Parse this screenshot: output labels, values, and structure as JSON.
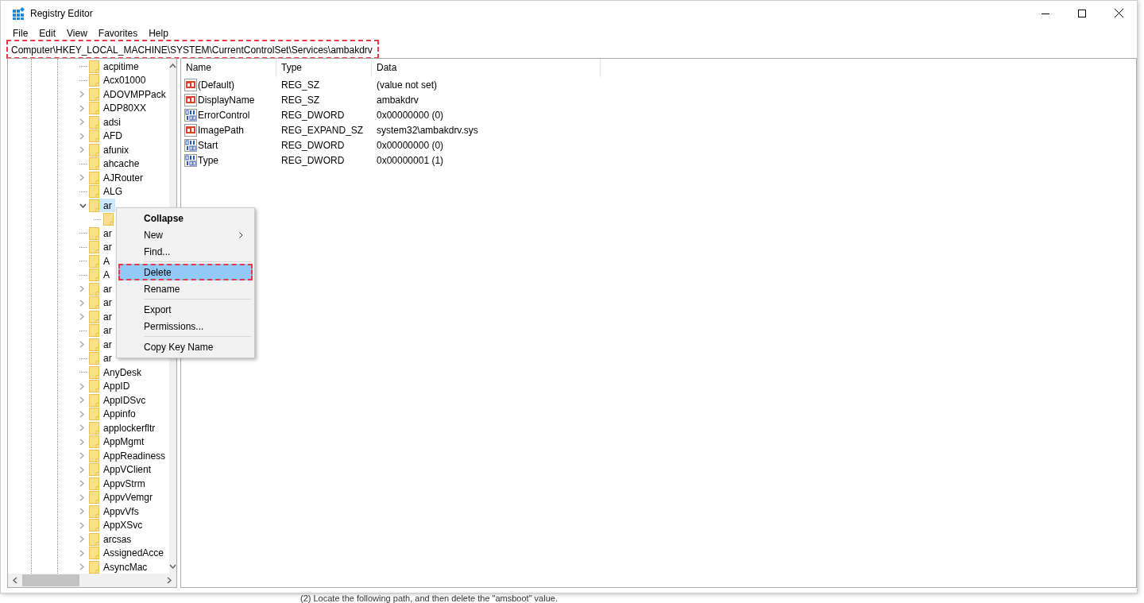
{
  "window": {
    "title": "Registry Editor"
  },
  "menu_bar": [
    "File",
    "Edit",
    "View",
    "Favorites",
    "Help"
  ],
  "address_bar": {
    "value": "Computer\\HKEY_LOCAL_MACHINE\\SYSTEM\\CurrentControlSet\\Services\\ambakdrv",
    "highlighted": true
  },
  "tree": {
    "items": [
      {
        "label": "acpitime",
        "expandable": false,
        "selected": false
      },
      {
        "label": "Acx01000",
        "expandable": false,
        "selected": false
      },
      {
        "label": "ADOVMPPack",
        "expandable": true,
        "expanded": false,
        "selected": false
      },
      {
        "label": "ADP80XX",
        "expandable": true,
        "expanded": false,
        "selected": false
      },
      {
        "label": "adsi",
        "expandable": true,
        "expanded": false,
        "selected": false
      },
      {
        "label": "AFD",
        "expandable": true,
        "expanded": false,
        "selected": false
      },
      {
        "label": "afunix",
        "expandable": true,
        "expanded": false,
        "selected": false
      },
      {
        "label": "ahcache",
        "expandable": false,
        "selected": false
      },
      {
        "label": "AJRouter",
        "expandable": true,
        "expanded": false,
        "selected": false
      },
      {
        "label": "ALG",
        "expandable": false,
        "selected": false
      },
      {
        "label": "ar",
        "expandable": true,
        "expanded": true,
        "selected": true,
        "children": [
          {
            "expandable": false,
            "selected": false
          }
        ]
      },
      {
        "label": "ar",
        "expandable": false,
        "selected": false
      },
      {
        "label": "ar",
        "expandable": false,
        "selected": false
      },
      {
        "label": "A",
        "expandable": false,
        "selected": false
      },
      {
        "label": "A",
        "expandable": false,
        "selected": false
      },
      {
        "label": "ar",
        "expandable": true,
        "expanded": false,
        "selected": false
      },
      {
        "label": "ar",
        "expandable": true,
        "expanded": false,
        "selected": false
      },
      {
        "label": "ar",
        "expandable": true,
        "expanded": false,
        "selected": false
      },
      {
        "label": "ar",
        "expandable": false,
        "selected": false
      },
      {
        "label": "ar",
        "expandable": true,
        "expanded": false,
        "selected": false
      },
      {
        "label": "ar",
        "expandable": false,
        "selected": false
      },
      {
        "label": "AnyDesk",
        "expandable": false,
        "selected": false
      },
      {
        "label": "AppID",
        "expandable": true,
        "expanded": false,
        "selected": false
      },
      {
        "label": "AppIDSvc",
        "expandable": true,
        "expanded": false,
        "selected": false
      },
      {
        "label": "Appinfo",
        "expandable": true,
        "expanded": false,
        "selected": false
      },
      {
        "label": "applockerfltr",
        "expandable": true,
        "expanded": false,
        "selected": false
      },
      {
        "label": "AppMgmt",
        "expandable": true,
        "expanded": false,
        "selected": false
      },
      {
        "label": "AppReadiness",
        "expandable": true,
        "expanded": false,
        "selected": false
      },
      {
        "label": "AppVClient",
        "expandable": true,
        "expanded": false,
        "selected": false
      },
      {
        "label": "AppvStrm",
        "expandable": true,
        "expanded": false,
        "selected": false
      },
      {
        "label": "AppvVemgr",
        "expandable": true,
        "expanded": false,
        "selected": false
      },
      {
        "label": "AppvVfs",
        "expandable": true,
        "expanded": false,
        "selected": false
      },
      {
        "label": "AppXSvc",
        "expandable": true,
        "expanded": false,
        "selected": false
      },
      {
        "label": "arcsas",
        "expandable": true,
        "expanded": false,
        "selected": false
      },
      {
        "label": "AssignedAcce",
        "expandable": true,
        "expanded": false,
        "selected": false
      },
      {
        "label": "AsyncMac",
        "expandable": true,
        "expanded": false,
        "selected": false
      }
    ]
  },
  "values": {
    "columns": [
      "Name",
      "Type",
      "Data"
    ],
    "rows": [
      {
        "kind": "string",
        "name": "(Default)",
        "type": "REG_SZ",
        "data": "(value not set)"
      },
      {
        "kind": "string",
        "name": "DisplayName",
        "type": "REG_SZ",
        "data": "ambakdrv"
      },
      {
        "kind": "binary",
        "name": "ErrorControl",
        "type": "REG_DWORD",
        "data": "0x00000000 (0)"
      },
      {
        "kind": "string",
        "name": "ImagePath",
        "type": "REG_EXPAND_SZ",
        "data": "system32\\ambakdrv.sys"
      },
      {
        "kind": "binary",
        "name": "Start",
        "type": "REG_DWORD",
        "data": "0x00000000 (0)"
      },
      {
        "kind": "binary",
        "name": "Type",
        "type": "REG_DWORD",
        "data": "0x00000001 (1)"
      }
    ]
  },
  "context_menu": {
    "items": [
      {
        "label": "Collapse",
        "bold": true,
        "submenu": false,
        "selected": false,
        "highlighted": false,
        "separator_after": false
      },
      {
        "label": "New",
        "bold": false,
        "submenu": true,
        "selected": false,
        "highlighted": false,
        "separator_after": false
      },
      {
        "label": "Find...",
        "bold": false,
        "submenu": false,
        "selected": false,
        "highlighted": false,
        "separator_after": true
      },
      {
        "label": "Delete",
        "bold": false,
        "submenu": false,
        "selected": true,
        "highlighted": true,
        "separator_after": false
      },
      {
        "label": "Rename",
        "bold": false,
        "submenu": false,
        "selected": false,
        "highlighted": false,
        "separator_after": true
      },
      {
        "label": "Export",
        "bold": false,
        "submenu": false,
        "selected": false,
        "highlighted": false,
        "separator_after": false
      },
      {
        "label": "Permissions...",
        "bold": false,
        "submenu": false,
        "selected": false,
        "highlighted": false,
        "separator_after": true
      },
      {
        "label": "Copy Key Name",
        "bold": false,
        "submenu": false,
        "selected": false,
        "highlighted": false,
        "separator_after": false
      }
    ]
  },
  "background_text": "(2) Locate the following path, and then delete the \"amsboot\" value."
}
